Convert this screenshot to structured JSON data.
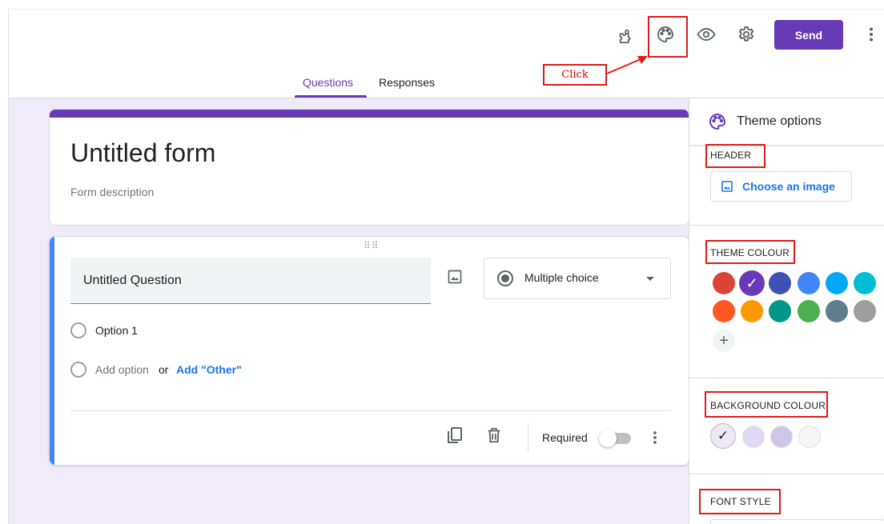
{
  "toolbar": {
    "addons_icon": "puzzle-icon",
    "theme_icon": "palette-icon",
    "preview_icon": "eye-icon",
    "settings_icon": "gear-icon",
    "send_label": "Send",
    "more_icon": "more-vert-icon"
  },
  "tabs": [
    {
      "label": "Questions",
      "active": true
    },
    {
      "label": "Responses",
      "active": false
    }
  ],
  "annotation": {
    "click_label": "Click"
  },
  "form": {
    "title": "Untitled form",
    "description_placeholder": "Form description",
    "question": {
      "title": "Untitled Question",
      "type_label": "Multiple choice",
      "options": [
        "Option 1"
      ],
      "add_option": "Add option",
      "or": "or",
      "add_other": "Add \"Other\"",
      "required_label": "Required",
      "required_on": false
    }
  },
  "theme_panel": {
    "title": "Theme options",
    "header_label": "HEADER",
    "choose_image": "Choose an image",
    "theme_colour_label": "THEME COLOUR",
    "theme_colours": [
      "#db4437",
      "#673ab7",
      "#3f51b5",
      "#4285f4",
      "#03a9f4",
      "#00bcd4",
      "#ff5722",
      "#ff9800",
      "#009688",
      "#4caf50",
      "#607d8b",
      "#9e9e9e"
    ],
    "selected_theme_colour": "#673ab7",
    "add_colour": "+",
    "background_colour_label": "BACKGROUND COLOUR",
    "background_colours": [
      "#ede7f6",
      "#e1d9f3",
      "#d1c4e9",
      "#f6f6f6"
    ],
    "font_style_label": "FONT STYLE"
  },
  "colors": {
    "accent": "#673ab7",
    "question_bar": "#4285f4",
    "workspace_bg": "#f0ebf8",
    "annotation_red": "#e11b1b"
  }
}
